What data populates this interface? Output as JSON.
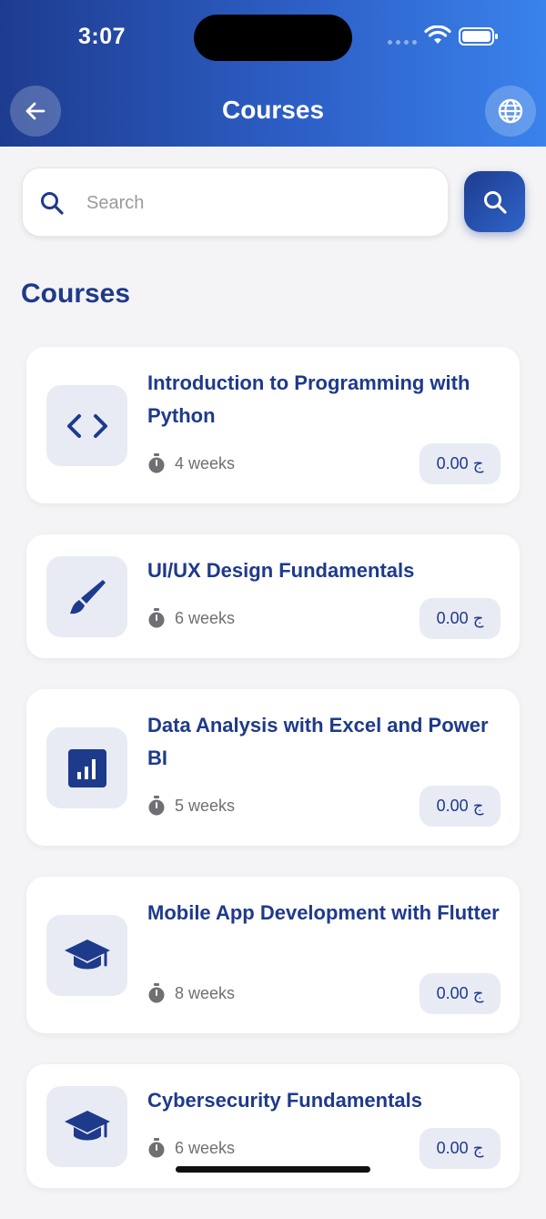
{
  "status_bar": {
    "time": "3:07"
  },
  "header": {
    "title": "Courses",
    "back_icon": "arrow-left-icon",
    "language_icon": "globe-icon"
  },
  "search": {
    "placeholder": "Search",
    "value": ""
  },
  "section": {
    "title": "Courses"
  },
  "courses": [
    {
      "title": "Introduction to Programming with Python",
      "duration": "4 weeks",
      "price": "0.00 ج",
      "icon": "code-icon"
    },
    {
      "title": "UI/UX Design Fundamentals",
      "duration": "6 weeks",
      "price": "0.00 ج",
      "icon": "paintbrush-icon"
    },
    {
      "title": "Data Analysis with Excel and Power BI",
      "duration": "5 weeks",
      "price": "0.00 ج",
      "icon": "bar-chart-icon"
    },
    {
      "title": "Mobile App Development with Flutter",
      "duration": "8 weeks",
      "price": "0.00 ج",
      "icon": "graduation-cap-icon"
    },
    {
      "title": "Cybersecurity Fundamentals",
      "duration": "6 weeks",
      "price": "0.00 ج",
      "icon": "graduation-cap-icon"
    }
  ],
  "colors": {
    "primary": "#1e3a8a",
    "accent": "#3a82ec",
    "thumb_bg": "#e8ebf4"
  }
}
